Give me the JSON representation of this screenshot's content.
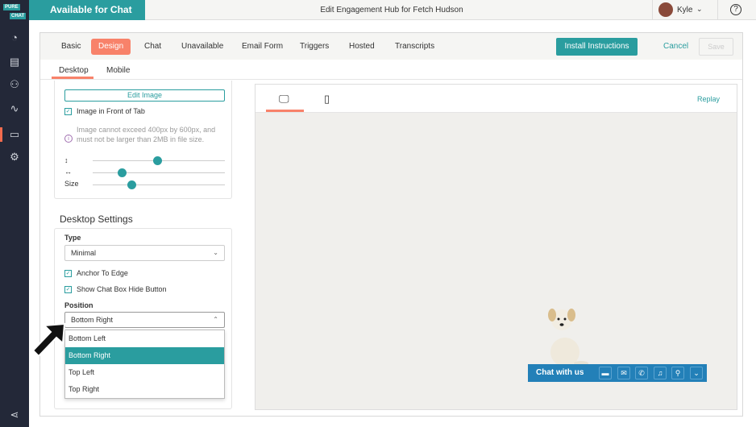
{
  "brand": {
    "logo_top": "PURE",
    "logo_bottom": "CHAT"
  },
  "sidebar": {
    "items": [
      {
        "icon": "gauge-icon"
      },
      {
        "icon": "document-icon"
      },
      {
        "icon": "users-icon"
      },
      {
        "icon": "analytics-icon"
      },
      {
        "icon": "widget-icon",
        "active": true
      },
      {
        "icon": "gear-icon"
      },
      {
        "icon": "share-icon"
      }
    ]
  },
  "header": {
    "status": "Available for Chat",
    "title": "Edit Engagement Hub for Fetch Hudson",
    "user": "Kyle",
    "help": "?"
  },
  "tabs": [
    "Basic",
    "Design",
    "Chat",
    "Unavailable",
    "Email Form",
    "Triggers",
    "Hosted",
    "Transcripts"
  ],
  "active_tab": "Design",
  "actions": {
    "install": "Install Instructions",
    "cancel": "Cancel",
    "save": "Save"
  },
  "subtabs": [
    "Desktop",
    "Mobile"
  ],
  "image_settings": {
    "edit_image": "Edit Image",
    "image_in_front": "Image in Front of Tab",
    "note": "Image cannot exceed 400px by 600px, and must not be larger than 2MB in file size.",
    "vertical_label": "↕",
    "horizontal_label": "↔",
    "size_label": "Size",
    "vertical_value": 0.49,
    "horizontal_value": 0.22,
    "size_value": 0.29
  },
  "desktop_settings": {
    "heading": "Desktop Settings",
    "type_label": "Type",
    "type_value": "Minimal",
    "anchor": "Anchor To Edge",
    "hide_button": "Show Chat Box Hide Button",
    "position_label": "Position",
    "position_value": "Bottom Right",
    "position_options": [
      "Bottom Left",
      "Bottom Right",
      "Top Left",
      "Top Right"
    ]
  },
  "preview": {
    "replay": "Replay",
    "chat_label": "Chat with us",
    "accent": "#2380b8"
  },
  "colors": {
    "teal": "#2a9d9f",
    "coral": "#f8826a",
    "sidebar": "#232838"
  }
}
